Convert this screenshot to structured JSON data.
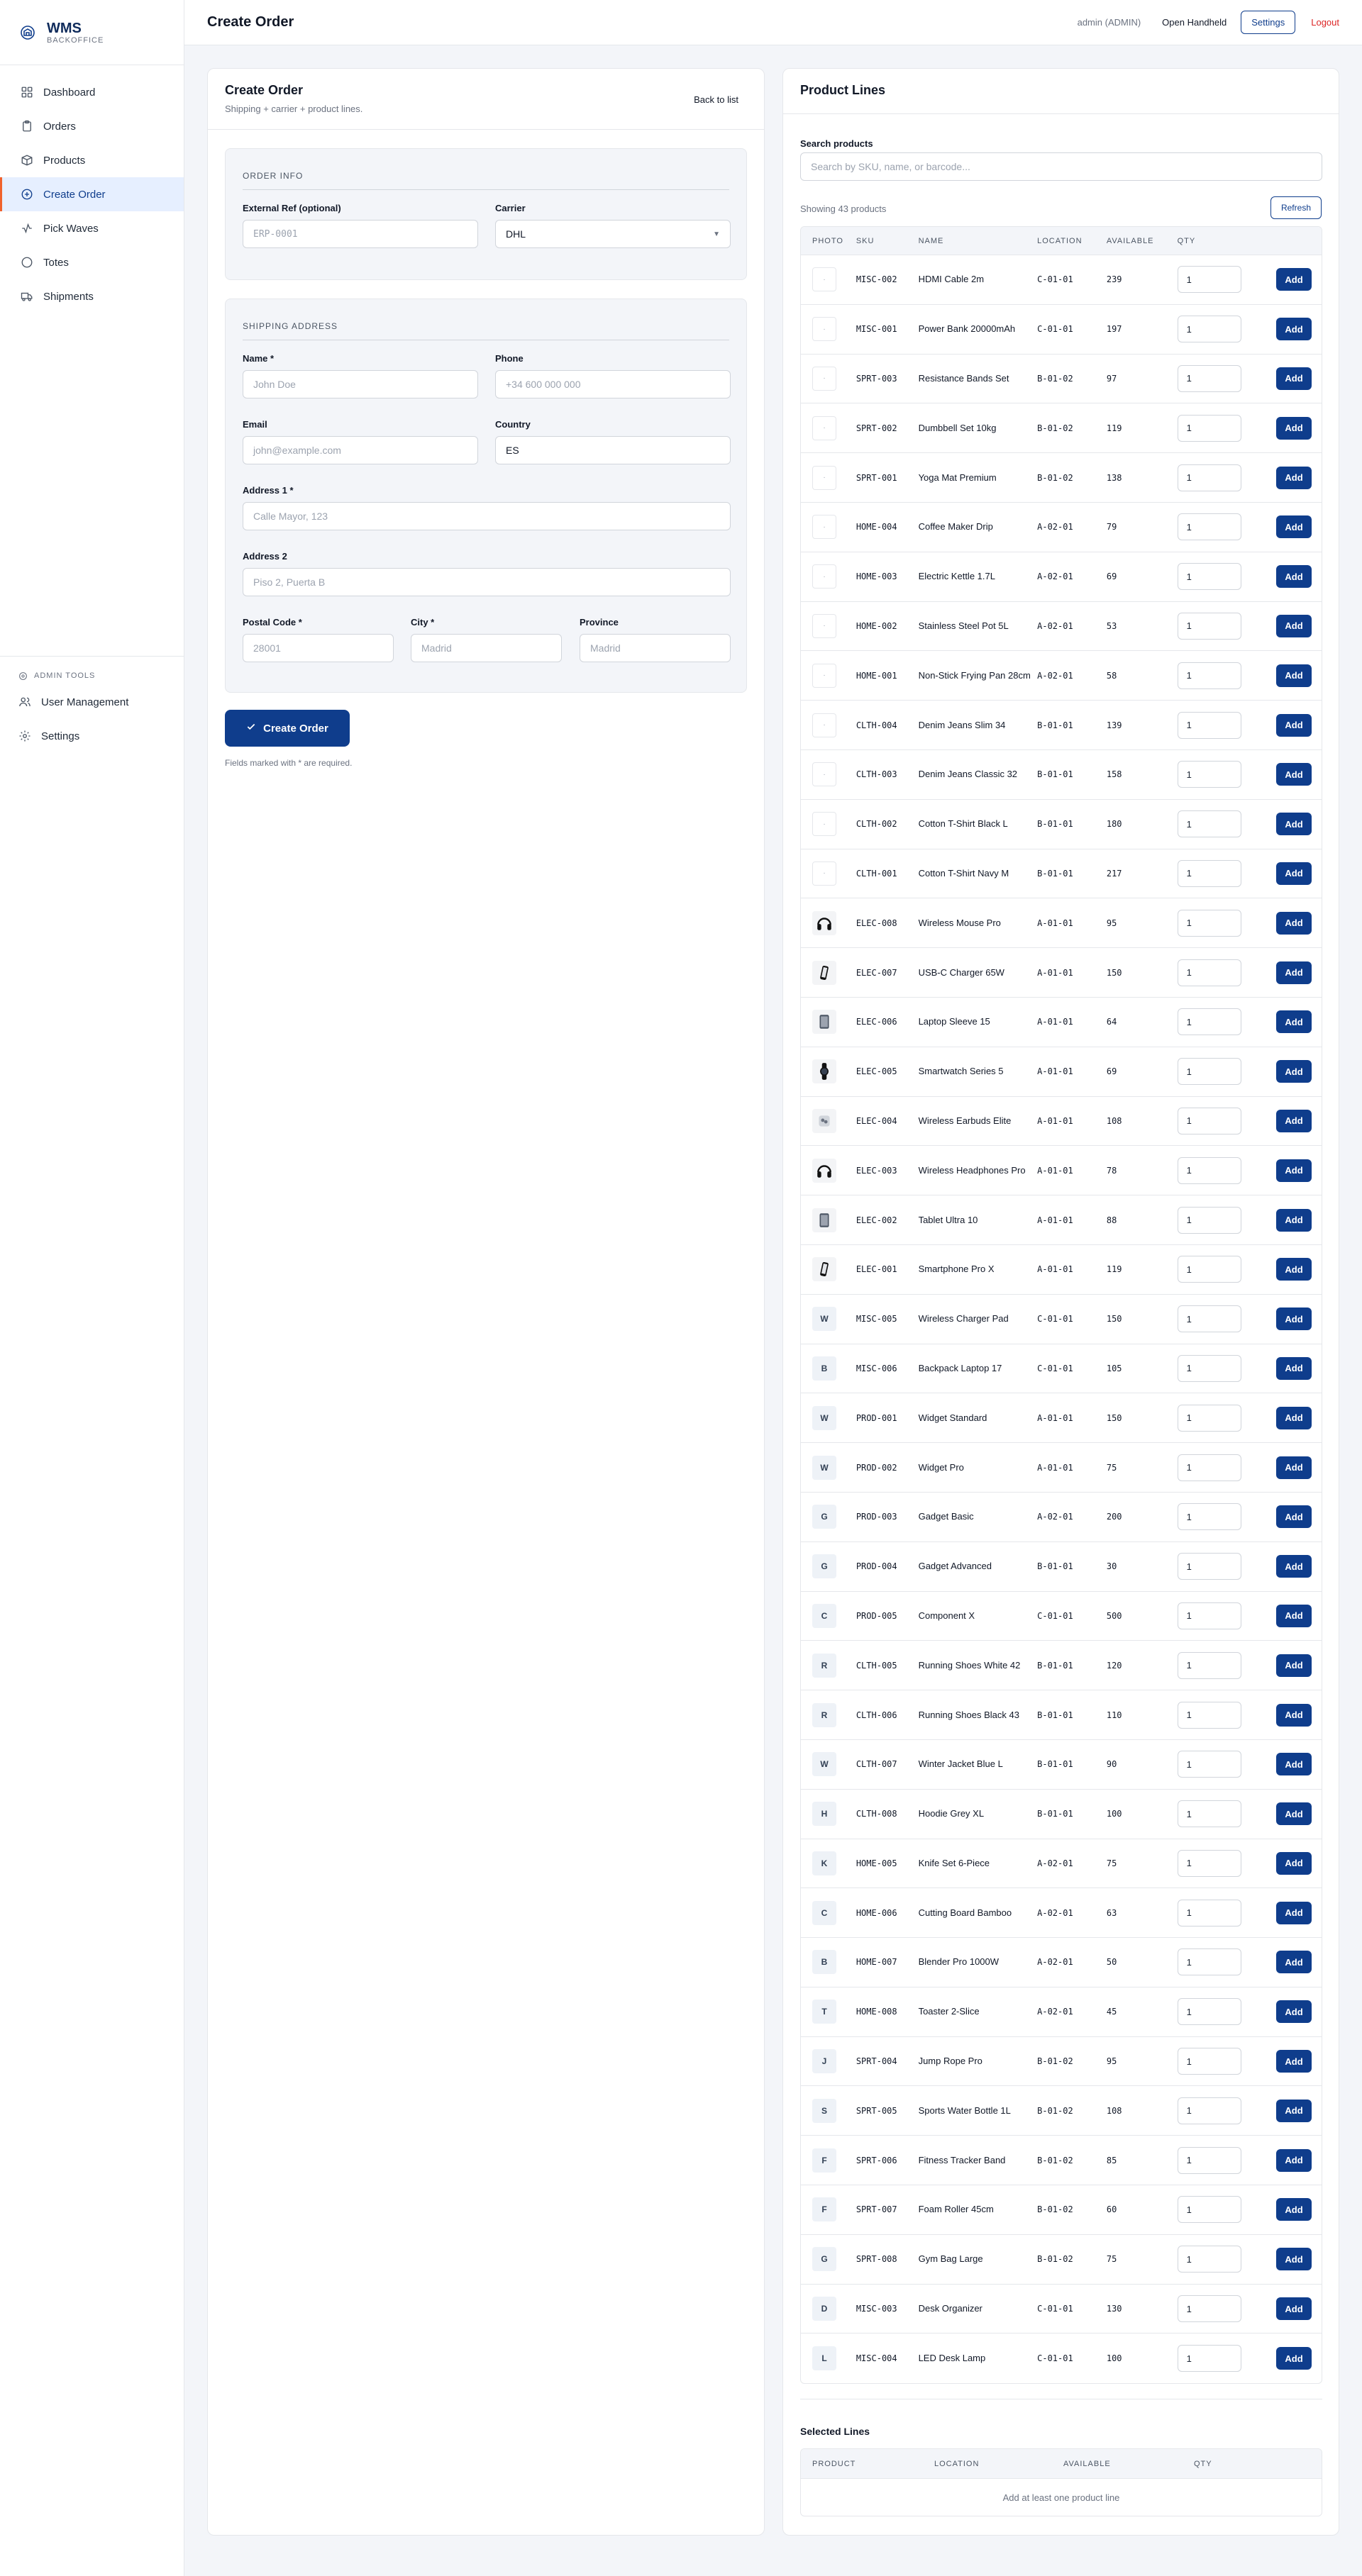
{
  "brand": {
    "title": "WMS",
    "subtitle": "BACKOFFICE"
  },
  "nav": [
    {
      "label": "Dashboard",
      "icon": "grid-icon",
      "active": false
    },
    {
      "label": "Orders",
      "icon": "clipboard-icon",
      "active": false
    },
    {
      "label": "Products",
      "icon": "box-icon",
      "active": false
    },
    {
      "label": "Create Order",
      "icon": "plus-circle-icon",
      "active": true
    },
    {
      "label": "Pick Waves",
      "icon": "activity-icon",
      "active": false
    },
    {
      "label": "Totes",
      "icon": "circle-icon",
      "active": false
    },
    {
      "label": "Shipments",
      "icon": "truck-icon",
      "active": false
    }
  ],
  "admin": {
    "heading": "ADMIN TOOLS",
    "items": [
      {
        "label": "User Management",
        "icon": "users-icon"
      },
      {
        "label": "Settings",
        "icon": "gear-icon"
      }
    ]
  },
  "topbar": {
    "title": "Create Order",
    "user": "admin (ADMIN)",
    "handheld": "Open Handheld",
    "settings": "Settings",
    "logout": "Logout"
  },
  "left": {
    "title": "Create Order",
    "subtitle": "Shipping + carrier + product lines.",
    "back": "Back to list",
    "order_info": {
      "heading": "ORDER INFO",
      "ext_ref_label": "External Ref (optional)",
      "ext_ref_placeholder": "ERP-0001",
      "carrier_label": "Carrier",
      "carrier_value": "DHL"
    },
    "shipping": {
      "heading": "SHIPPING ADDRESS",
      "name_label": "Name *",
      "name_placeholder": "John Doe",
      "phone_label": "Phone",
      "phone_placeholder": "+34 600 000 000",
      "email_label": "Email",
      "email_placeholder": "john@example.com",
      "country_label": "Country",
      "country_value": "ES",
      "addr1_label": "Address 1 *",
      "addr1_placeholder": "Calle Mayor, 123",
      "addr2_label": "Address 2",
      "addr2_placeholder": "Piso 2, Puerta B",
      "postal_label": "Postal Code *",
      "postal_placeholder": "28001",
      "city_label": "City *",
      "city_placeholder": "Madrid",
      "province_label": "Province",
      "province_placeholder": "Madrid"
    },
    "create_button": "Create Order",
    "required_note": "Fields marked with * are required."
  },
  "right": {
    "title": "Product Lines",
    "search_label": "Search products",
    "search_placeholder": "Search by SKU, name, or barcode...",
    "showing": "Showing 43 products",
    "refresh": "Refresh",
    "columns": {
      "photo": "PHOTO",
      "sku": "SKU",
      "name": "NAME",
      "location": "LOCATION",
      "available": "AVAILABLE",
      "qty": "QTY"
    },
    "add_label": "Add",
    "qty_default": "1",
    "products": [
      {
        "sku": "MISC-002",
        "name": "HDMI Cable 2m",
        "location": "C-01-01",
        "available": "239",
        "photo": "blank",
        "thumb": "·"
      },
      {
        "sku": "MISC-001",
        "name": "Power Bank 20000mAh",
        "location": "C-01-01",
        "available": "197",
        "photo": "blank",
        "thumb": "·"
      },
      {
        "sku": "SPRT-003",
        "name": "Resistance Bands Set",
        "location": "B-01-02",
        "available": "97",
        "photo": "blank",
        "thumb": "·"
      },
      {
        "sku": "SPRT-002",
        "name": "Dumbbell Set 10kg",
        "location": "B-01-02",
        "available": "119",
        "photo": "blank",
        "thumb": "·"
      },
      {
        "sku": "SPRT-001",
        "name": "Yoga Mat Premium",
        "location": "B-01-02",
        "available": "138",
        "photo": "blank",
        "thumb": "·"
      },
      {
        "sku": "HOME-004",
        "name": "Coffee Maker Drip",
        "location": "A-02-01",
        "available": "79",
        "photo": "blank",
        "thumb": "·"
      },
      {
        "sku": "HOME-003",
        "name": "Electric Kettle 1.7L",
        "location": "A-02-01",
        "available": "69",
        "photo": "blank",
        "thumb": "·"
      },
      {
        "sku": "HOME-002",
        "name": "Stainless Steel Pot 5L",
        "location": "A-02-01",
        "available": "53",
        "photo": "blank",
        "thumb": "·"
      },
      {
        "sku": "HOME-001",
        "name": "Non-Stick Frying Pan 28cm",
        "location": "A-02-01",
        "available": "58",
        "photo": "blank",
        "thumb": "·"
      },
      {
        "sku": "CLTH-004",
        "name": "Denim Jeans Slim 34",
        "location": "B-01-01",
        "available": "139",
        "photo": "blank",
        "thumb": "·"
      },
      {
        "sku": "CLTH-003",
        "name": "Denim Jeans Classic 32",
        "location": "B-01-01",
        "available": "158",
        "photo": "blank",
        "thumb": "·"
      },
      {
        "sku": "CLTH-002",
        "name": "Cotton T-Shirt Black L",
        "location": "B-01-01",
        "available": "180",
        "photo": "blank",
        "thumb": "·"
      },
      {
        "sku": "CLTH-001",
        "name": "Cotton T-Shirt Navy M",
        "location": "B-01-01",
        "available": "217",
        "photo": "blank",
        "thumb": "·"
      },
      {
        "sku": "ELEC-008",
        "name": "Wireless Mouse Pro",
        "location": "A-01-01",
        "available": "95",
        "photo": "headphones",
        "thumb": ""
      },
      {
        "sku": "ELEC-007",
        "name": "USB-C Charger 65W",
        "location": "A-01-01",
        "available": "150",
        "photo": "phone",
        "thumb": ""
      },
      {
        "sku": "ELEC-006",
        "name": "Laptop Sleeve 15",
        "location": "A-01-01",
        "available": "64",
        "photo": "tablet",
        "thumb": ""
      },
      {
        "sku": "ELEC-005",
        "name": "Smartwatch Series 5",
        "location": "A-01-01",
        "available": "69",
        "photo": "watch",
        "thumb": ""
      },
      {
        "sku": "ELEC-004",
        "name": "Wireless Earbuds Elite",
        "location": "A-01-01",
        "available": "108",
        "photo": "earbuds",
        "thumb": ""
      },
      {
        "sku": "ELEC-003",
        "name": "Wireless Headphones Pro",
        "location": "A-01-01",
        "available": "78",
        "photo": "headphones",
        "thumb": ""
      },
      {
        "sku": "ELEC-002",
        "name": "Tablet Ultra 10",
        "location": "A-01-01",
        "available": "88",
        "photo": "tablet",
        "thumb": ""
      },
      {
        "sku": "ELEC-001",
        "name": "Smartphone Pro X",
        "location": "A-01-01",
        "available": "119",
        "photo": "phone",
        "thumb": ""
      },
      {
        "sku": "MISC-005",
        "name": "Wireless Charger Pad",
        "location": "C-01-01",
        "available": "150",
        "photo": "letter",
        "thumb": "W"
      },
      {
        "sku": "MISC-006",
        "name": "Backpack Laptop 17",
        "location": "C-01-01",
        "available": "105",
        "photo": "letter",
        "thumb": "B"
      },
      {
        "sku": "PROD-001",
        "name": "Widget Standard",
        "location": "A-01-01",
        "available": "150",
        "photo": "letter",
        "thumb": "W"
      },
      {
        "sku": "PROD-002",
        "name": "Widget Pro",
        "location": "A-01-01",
        "available": "75",
        "photo": "letter",
        "thumb": "W"
      },
      {
        "sku": "PROD-003",
        "name": "Gadget Basic",
        "location": "A-02-01",
        "available": "200",
        "photo": "letter",
        "thumb": "G"
      },
      {
        "sku": "PROD-004",
        "name": "Gadget Advanced",
        "location": "B-01-01",
        "available": "30",
        "photo": "letter",
        "thumb": "G"
      },
      {
        "sku": "PROD-005",
        "name": "Component X",
        "location": "C-01-01",
        "available": "500",
        "photo": "letter",
        "thumb": "C"
      },
      {
        "sku": "CLTH-005",
        "name": "Running Shoes White 42",
        "location": "B-01-01",
        "available": "120",
        "photo": "letter",
        "thumb": "R"
      },
      {
        "sku": "CLTH-006",
        "name": "Running Shoes Black 43",
        "location": "B-01-01",
        "available": "110",
        "photo": "letter",
        "thumb": "R"
      },
      {
        "sku": "CLTH-007",
        "name": "Winter Jacket Blue L",
        "location": "B-01-01",
        "available": "90",
        "photo": "letter",
        "thumb": "W"
      },
      {
        "sku": "CLTH-008",
        "name": "Hoodie Grey XL",
        "location": "B-01-01",
        "available": "100",
        "photo": "letter",
        "thumb": "H"
      },
      {
        "sku": "HOME-005",
        "name": "Knife Set 6-Piece",
        "location": "A-02-01",
        "available": "75",
        "photo": "letter",
        "thumb": "K"
      },
      {
        "sku": "HOME-006",
        "name": "Cutting Board Bamboo",
        "location": "A-02-01",
        "available": "63",
        "photo": "letter",
        "thumb": "C"
      },
      {
        "sku": "HOME-007",
        "name": "Blender Pro 1000W",
        "location": "A-02-01",
        "available": "50",
        "photo": "letter",
        "thumb": "B"
      },
      {
        "sku": "HOME-008",
        "name": "Toaster 2-Slice",
        "location": "A-02-01",
        "available": "45",
        "photo": "letter",
        "thumb": "T"
      },
      {
        "sku": "SPRT-004",
        "name": "Jump Rope Pro",
        "location": "B-01-02",
        "available": "95",
        "photo": "letter",
        "thumb": "J"
      },
      {
        "sku": "SPRT-005",
        "name": "Sports Water Bottle 1L",
        "location": "B-01-02",
        "available": "108",
        "photo": "letter",
        "thumb": "S"
      },
      {
        "sku": "SPRT-006",
        "name": "Fitness Tracker Band",
        "location": "B-01-02",
        "available": "85",
        "photo": "letter",
        "thumb": "F"
      },
      {
        "sku": "SPRT-007",
        "name": "Foam Roller 45cm",
        "location": "B-01-02",
        "available": "60",
        "photo": "letter",
        "thumb": "F"
      },
      {
        "sku": "SPRT-008",
        "name": "Gym Bag Large",
        "location": "B-01-02",
        "available": "75",
        "photo": "letter",
        "thumb": "G"
      },
      {
        "sku": "MISC-003",
        "name": "Desk Organizer",
        "location": "C-01-01",
        "available": "130",
        "photo": "letter",
        "thumb": "D"
      },
      {
        "sku": "MISC-004",
        "name": "LED Desk Lamp",
        "location": "C-01-01",
        "available": "100",
        "photo": "letter",
        "thumb": "L"
      }
    ],
    "selected": {
      "title": "Selected Lines",
      "columns": {
        "product": "PRODUCT",
        "location": "LOCATION",
        "available": "AVAILABLE",
        "qty": "QTY"
      },
      "empty": "Add at least one product line"
    }
  },
  "colors": {
    "primary": "#0f3d8c",
    "accent": "#f0622d",
    "danger": "#dc2626"
  }
}
